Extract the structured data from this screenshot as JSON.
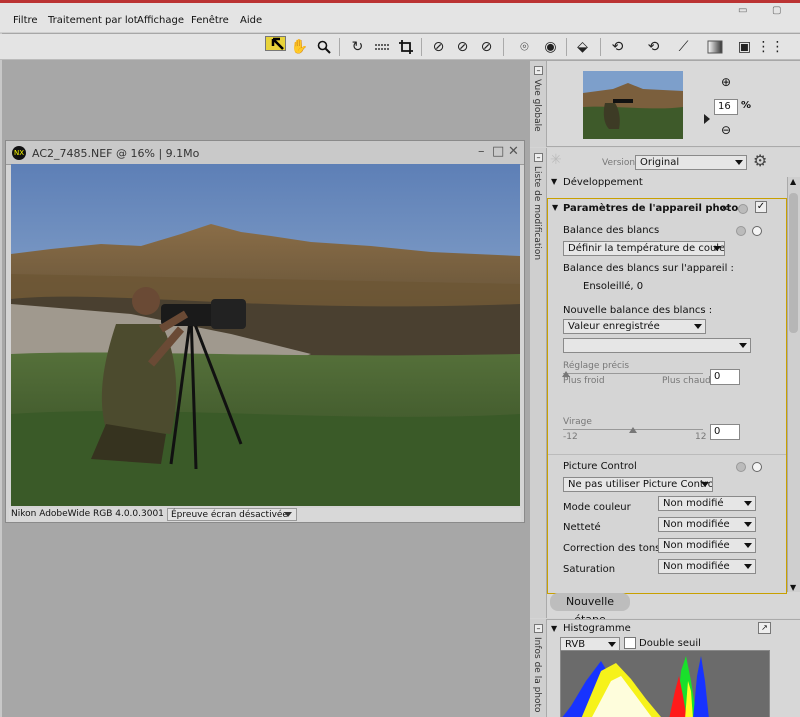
{
  "menubar": {
    "items": [
      {
        "label": "Filtre"
      },
      {
        "label": "Traitement par lot"
      },
      {
        "label": "Affichage"
      },
      {
        "label": "Fenêtre"
      },
      {
        "label": "Aide"
      }
    ]
  },
  "toolbar": {
    "tools": [
      "select-arrow-icon",
      "hand-icon",
      "zoom-icon",
      "rotate-ccw-icon",
      "straighten-icon",
      "crop-icon",
      "dust-brush-icon",
      "control-point-plus-icon",
      "control-point-minus-icon",
      "red-eye-icon",
      "eye-icon",
      "tag-icon",
      "lasso-plus-icon",
      "lasso-minus-icon",
      "brush-icon",
      "gradient-icon",
      "select-region-icon",
      "grid-icon"
    ]
  },
  "image_window": {
    "title": "AC2_7485.NEF @ 16% | 9.1Mo",
    "profile": "Nikon AdobeWide RGB 4.0.0.3001",
    "softproof": "Épreuve écran désactivée"
  },
  "overview": {
    "tab_label": "Vue globale",
    "zoom_value": "16",
    "zoom_unit": "%"
  },
  "adjust": {
    "tab_label": "Liste de modification",
    "version_label": "Version",
    "version_value": "Original",
    "development_label": "Développement",
    "section_title": "Paramètres de l'appareil photo",
    "wb_title": "Balance des blancs",
    "wb_select": "Définir la température de couleur",
    "wb_camera_label": "Balance des blancs sur l'appareil :",
    "wb_camera_value": "Ensoleillé, 0",
    "wb_new_label": "Nouvelle balance des blancs :",
    "wb_new_select": "Valeur enregistrée",
    "wb_new_select2": "",
    "fine_label": "Réglage précis",
    "fine_left": "Plus froid",
    "fine_right": "Plus chaud",
    "fine_value": "0",
    "tint_label": "Virage",
    "tint_min": "-12",
    "tint_max": "12",
    "tint_value": "0",
    "picture_control_title": "Picture Control",
    "pc_select": "Ne pas utiliser Picture Control",
    "pc_rows": [
      {
        "label": "Mode couleur",
        "value": "Non modifié"
      },
      {
        "label": "Netteté",
        "value": "Non modifiée"
      },
      {
        "label": "Correction des tons",
        "value": "Non modifiée"
      },
      {
        "label": "Saturation",
        "value": "Non modifiée"
      }
    ],
    "new_step_label": "Nouvelle étape"
  },
  "histogram": {
    "tab_label": "Infos de la photo",
    "title": "Histogramme",
    "channel": "RVB",
    "double_threshold": "Double seuil"
  }
}
